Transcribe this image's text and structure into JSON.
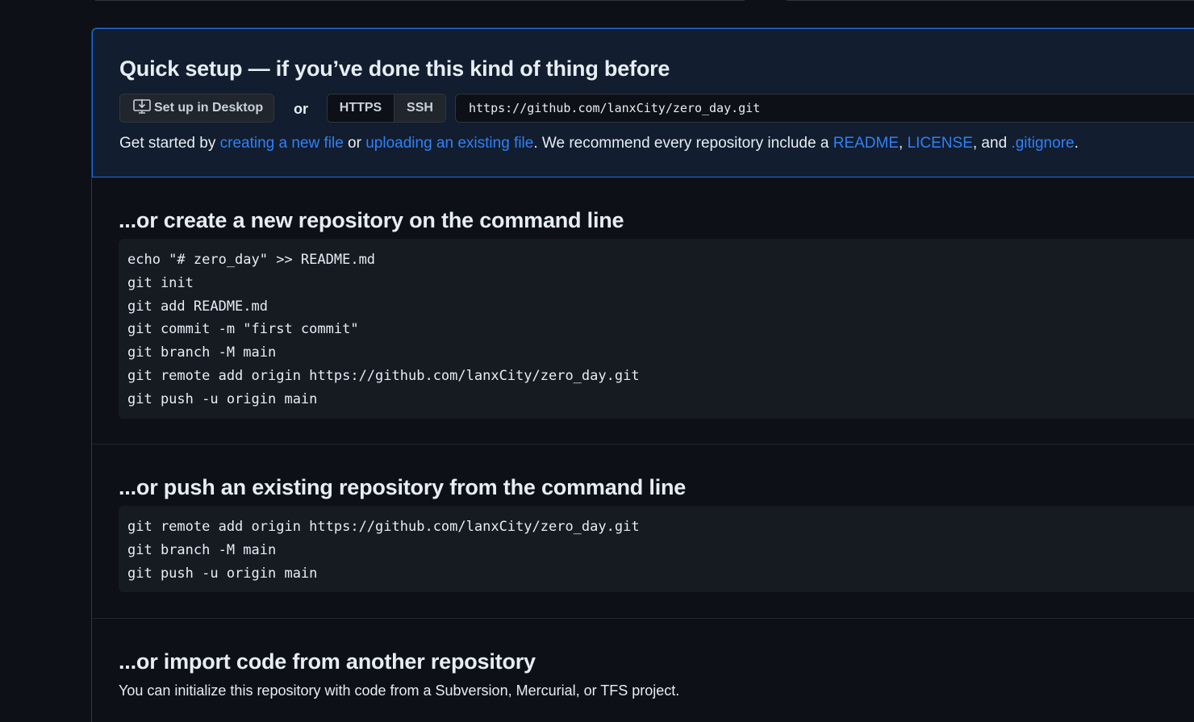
{
  "quick_setup": {
    "title": "Quick setup — if you’ve done this kind of thing before",
    "desktop_button": "Set up in Desktop",
    "or": "or",
    "protocols": [
      "HTTPS",
      "SSH"
    ],
    "clone_url": "https://github.com/lanxCity/zero_day.git",
    "intro": {
      "t1": "Get started by ",
      "link_new_file": "creating a new file",
      "t2": " or ",
      "link_upload": "uploading an existing file",
      "t3": ". We recommend every repository include a ",
      "link_readme": "README",
      "t4": ", ",
      "link_license": "LICENSE",
      "t5": ", and ",
      "link_gitignore": ".gitignore",
      "t6": "."
    }
  },
  "create_section": {
    "title": "...or create a new repository on the command line",
    "lines": [
      "echo \"# zero_day\" >> README.md",
      "git init",
      "git add README.md",
      "git commit -m \"first commit\"",
      "git branch -M main",
      "git remote add origin https://github.com/lanxCity/zero_day.git",
      "git push -u origin main"
    ]
  },
  "push_section": {
    "title": "...or push an existing repository from the command line",
    "lines": [
      "git remote add origin https://github.com/lanxCity/zero_day.git",
      "git branch -M main",
      "git push -u origin main"
    ]
  },
  "import_section": {
    "title": "...or import code from another repository",
    "description": "You can initialize this repository with code from a Subversion, Mercurial, or TFS project."
  },
  "colors": {
    "background": "#0d1117",
    "link": "#2f81f7",
    "quick_setup_bg": "#121d2f",
    "quick_setup_border": "#1f6feb",
    "code_bg": "#161b22"
  },
  "icons": {
    "desktop": "desktop-download-icon"
  }
}
